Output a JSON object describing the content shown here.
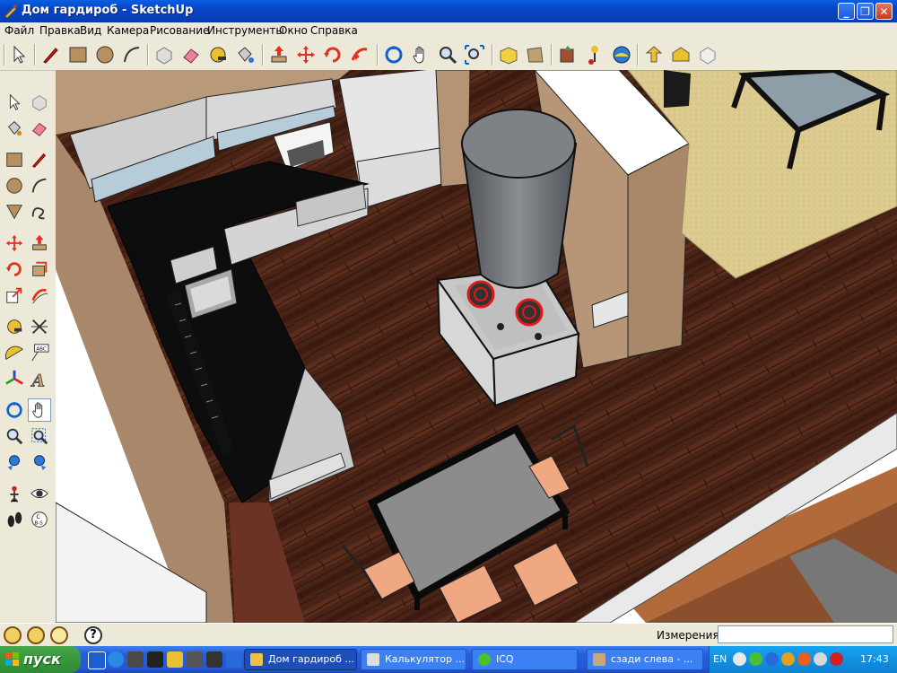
{
  "window": {
    "title": "Дом гардироб - SketchUp",
    "minimize": "_",
    "maximize": "❐",
    "close": "✕"
  },
  "menu": [
    "Файл",
    "Правка",
    "Вид",
    "Камера",
    "Рисование",
    "Инструменты",
    "Окно",
    "Справка"
  ],
  "toolbar_top": [
    "select",
    "pencil",
    "rectangle",
    "circle",
    "arc",
    "make-component",
    "eraser",
    "tape-measure",
    "paint-bucket",
    "push-pull",
    "move",
    "rotate",
    "follow-me",
    "orbit",
    "pan",
    "zoom",
    "zoom-extents",
    "get-models",
    "share-model",
    "push-component",
    "add-location",
    "toggle-terrain",
    "photo-textures",
    "get-photo-texture",
    "share-component"
  ],
  "toolbar_left": [
    "select",
    "make-component",
    "paint-bucket",
    "eraser",
    "rectangle",
    "line",
    "circle",
    "arc",
    "polygon",
    "freehand",
    "move",
    "push-pull",
    "rotate",
    "follow-me",
    "scale",
    "offset",
    "tape-measure",
    "dimension",
    "protractor",
    "text",
    "axes",
    "3d-text",
    "orbit",
    "pan",
    "zoom",
    "zoom-window",
    "previous-view",
    "zoom-extents",
    "position-camera",
    "look-around",
    "walk",
    "section-plane"
  ],
  "status": {
    "measure_label": "Измерения",
    "measure_value": ""
  },
  "taskbar": {
    "start_label": "пуск",
    "tasks": [
      {
        "label": "Дом гардироб ...",
        "active": true
      },
      {
        "label": "Калькулятор ...",
        "active": false
      },
      {
        "label": "ICQ",
        "active": false
      },
      {
        "label": "сзади слева - ...",
        "active": false
      }
    ],
    "tray_lang": "EN",
    "clock": "17:43"
  },
  "colors": {
    "titlebar": "#0a5fe0",
    "floor_wood": "#4a2518",
    "countertop": "#0e0e0e",
    "rug": "#d9c88c",
    "wall_tan": "#b49474",
    "cabinet_gray": "#c9c9c9"
  }
}
